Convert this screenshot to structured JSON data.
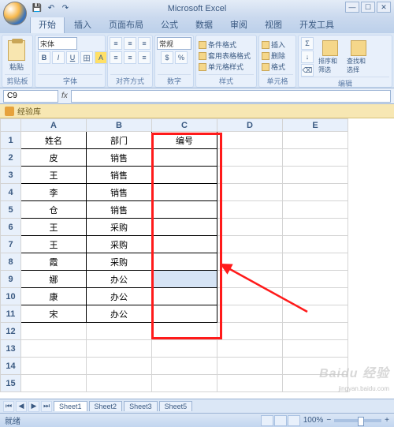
{
  "app_title": "Microsoft Excel",
  "tabs": [
    "开始",
    "插入",
    "页面布局",
    "公式",
    "数据",
    "审阅",
    "视图",
    "开发工具"
  ],
  "active_tab": 0,
  "ribbon_groups": {
    "clipboard": {
      "label": "剪贴板",
      "paste": "粘贴"
    },
    "font": {
      "label": "字体",
      "name": "宋体"
    },
    "align": {
      "label": "对齐方式"
    },
    "number": {
      "label": "数字",
      "format": "常规"
    },
    "styles": {
      "label": "样式",
      "cond": "条件格式",
      "table": "套用表格格式",
      "cell": "单元格样式"
    },
    "cells": {
      "label": "单元格",
      "insert": "插入",
      "delete": "删除",
      "format": "格式"
    },
    "editing": {
      "label": "编辑",
      "sort": "排序和筛选",
      "find": "查找和选择"
    }
  },
  "namebox": "C9",
  "security_msg": "经验库",
  "columns": [
    "A",
    "B",
    "C",
    "D",
    "E"
  ],
  "rows": [
    1,
    2,
    3,
    4,
    5,
    6,
    7,
    8,
    9,
    10,
    11,
    12,
    13,
    14,
    15
  ],
  "chart_data": {
    "type": "table",
    "headers": {
      "A": "姓名",
      "B": "部门",
      "C": "编号"
    },
    "rows": [
      {
        "A": "皮",
        "B": "销售",
        "C": ""
      },
      {
        "A": "王",
        "B": "销售",
        "C": ""
      },
      {
        "A": "李",
        "B": "销售",
        "C": ""
      },
      {
        "A": "仓",
        "B": "销售",
        "C": ""
      },
      {
        "A": "王",
        "B": "采购",
        "C": ""
      },
      {
        "A": "王",
        "B": "采购",
        "C": ""
      },
      {
        "A": "霞",
        "B": "采购",
        "C": ""
      },
      {
        "A": "娜",
        "B": "办公",
        "C": ""
      },
      {
        "A": "康",
        "B": "办公",
        "C": ""
      },
      {
        "A": "宋",
        "B": "办公",
        "C": ""
      }
    ]
  },
  "sheet_tabs": [
    "Sheet1",
    "Sheet2",
    "Sheet3",
    "Sheet5"
  ],
  "status_text": "就绪",
  "zoom": "100%",
  "watermark": "Baidu 经验",
  "watermark_url": "jingyan.baidu.com"
}
